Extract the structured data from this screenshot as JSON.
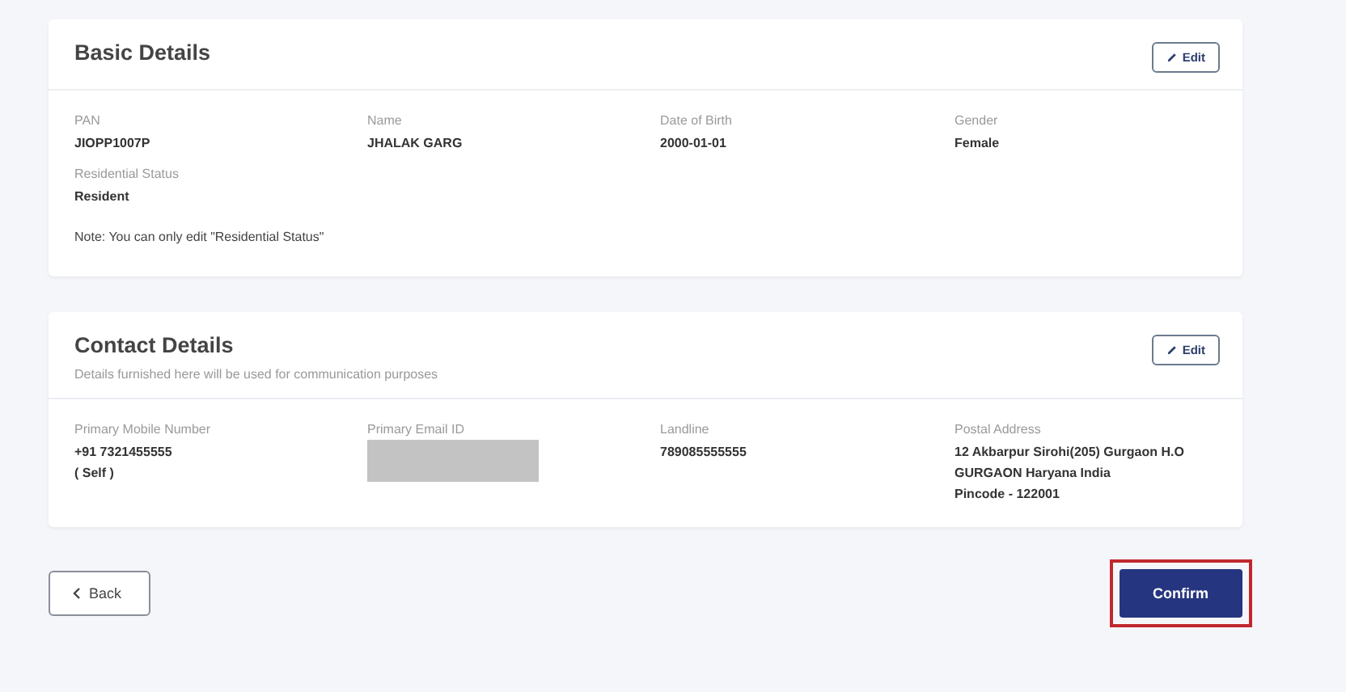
{
  "sections": [
    {
      "title": "Basic Details",
      "edit_button": "Edit",
      "fields": [
        {
          "label": "PAN",
          "lines": [
            "JIOPP1007P"
          ]
        },
        {
          "label": "Name",
          "lines": [
            "JHALAK GARG"
          ]
        },
        {
          "label": "Date of Birth",
          "lines": [
            "2000-01-01"
          ]
        },
        {
          "label": "Gender",
          "lines": [
            "Female"
          ]
        },
        {
          "label": "Residential Status",
          "lines": [
            "Resident"
          ]
        }
      ],
      "note": "Note:  You can only edit \"Residential Status\""
    },
    {
      "title": "Contact Details",
      "edit_button": "Edit",
      "subtitle": "Details furnished here will be used for communication purposes",
      "fields": [
        {
          "label": "Primary Mobile Number",
          "lines": [
            "+91 7321455555",
            "( Self )"
          ]
        },
        {
          "label": "Primary Email ID",
          "redacted": true
        },
        {
          "label": "Landline",
          "lines": [
            "789085555555"
          ]
        },
        {
          "label": "Postal Address",
          "lines": [
            "12 Akbarpur Sirohi(205) Gurgaon H.O",
            "GURGAON Haryana India",
            "Pincode - 122001"
          ]
        }
      ]
    }
  ],
  "back_button": "Back",
  "confirm_button": {
    "label": "Confirm",
    "highlighted": true
  }
}
